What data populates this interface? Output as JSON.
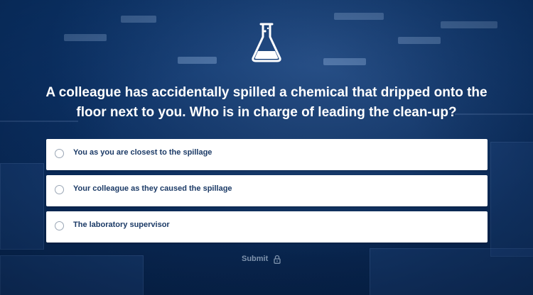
{
  "icons": {
    "header": "flask-icon",
    "submit": "lock-icon"
  },
  "question": {
    "text": "A colleague has accidentally spilled a chemical that dripped onto the floor next to you. Who is in charge of leading the clean-up?"
  },
  "options": [
    {
      "label": "You as you are closest to the spillage",
      "selected": false
    },
    {
      "label": "Your colleague as they caused the spillage",
      "selected": false
    },
    {
      "label": "The laboratory supervisor",
      "selected": false
    }
  ],
  "submit": {
    "label": "Submit",
    "disabled": true
  },
  "colors": {
    "background": "#0b2a57",
    "question_text": "#ffffff",
    "option_bg": "#ffffff",
    "option_text": "#1b3a66",
    "submit_disabled": "#7f93ad"
  }
}
